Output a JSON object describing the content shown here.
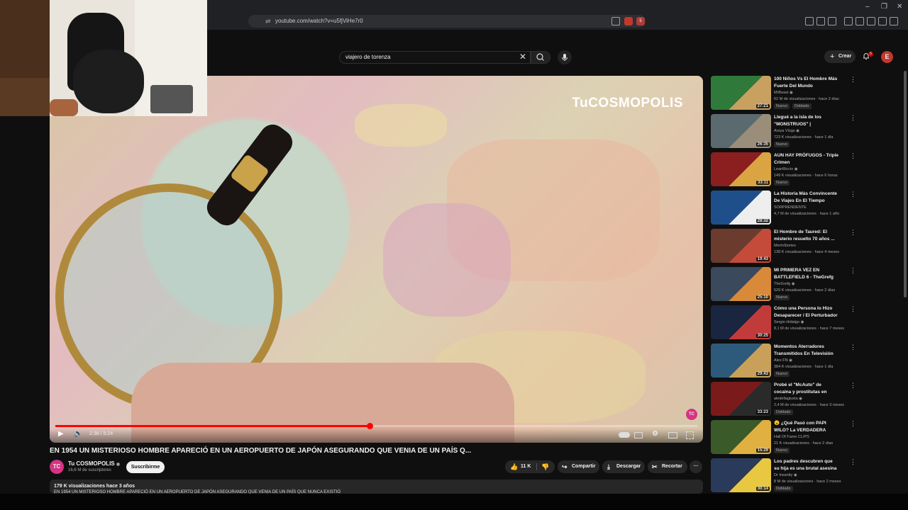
{
  "browser": {
    "url": "youtube.com/watch?v=u5fjViHe7r0",
    "ext_badge": "5",
    "win_minimize": "–",
    "win_maximize": "❐",
    "win_close": "✕",
    "page_close": "✕"
  },
  "header": {
    "search_value": "viajero de torenza",
    "search_clear": "✕",
    "create_label": "Crear",
    "notification_count": "5",
    "avatar_letter": "E"
  },
  "video": {
    "watermark": "TuCOSMOPOLIS",
    "time": "2:38 / 5:24",
    "progress": 0.49,
    "corner_badge": "TC",
    "title": "EN 1954 UN MISTERIOSO HOMBRE APARECIÓ EN UN AEROPUERTO DE JAPÓN ASEGURANDO QUE VENIA DE UN PAÍS Q..."
  },
  "channel": {
    "avatar_text": "TC",
    "name": "Tu COSMOPOLIS",
    "subscribers": "16,6 M de suscriptores",
    "subscribe_label": "Suscribirme"
  },
  "actions": {
    "likes": "11 K",
    "share": "Compartir",
    "download": "Descargar",
    "clip": "Recortar",
    "more": "···"
  },
  "description": {
    "meta": "179 K visualizaciones  hace 3 años",
    "text": "EN 1954 UN MISTERIOSO HOMBRE APARECIÓ EN UN AEROPUERTO DE JAPÓN ASEGURANDO QUE VENIA DE UN PAÍS QUE NUNCA EXISTIÓ"
  },
  "recommendations": [
    {
      "title": "100 Niños Vs El Hombre Más Fuerte Del Mundo",
      "channel": "MrBeast ◉",
      "meta": "62 M de visualizaciones · hace 2 días",
      "badges": [
        "Nuevo",
        "Doblado"
      ],
      "duration": "27:21",
      "colors": [
        "#2f7a3b",
        "#c8a060"
      ]
    },
    {
      "title": "Llegué a la isla de los \"MONSTRUOS\" | GALÁPAGOS ...",
      "channel": "Areya Vlogs ◉",
      "meta": "723 K visualizaciones · hace 1 día",
      "badges": [
        "Nuevo"
      ],
      "duration": "26:35",
      "colors": [
        "#5b6a6f",
        "#9a8e7a"
      ]
    },
    {
      "title": "AUN HAY PRÓFUGOS - Triple Crimen",
      "channel": "LeanRiccio ◉",
      "meta": "149 K visualizaciones · hace 6 horas",
      "badges": [
        "Nuevo"
      ],
      "duration": "33:11",
      "colors": [
        "#8b1e1e",
        "#d9a441"
      ]
    },
    {
      "title": "La Historia Más Convincente De Viajes En El Tiempo",
      "channel": "SORPRENDENTE",
      "meta": "4,7 M de visualizaciones · hace 1 año",
      "badges": [],
      "duration": "28:32",
      "colors": [
        "#1e4f8b",
        "#eeeeee"
      ]
    },
    {
      "title": "El Hombre de Taured: El misterio resuelto 70 años ...",
      "channel": "MerinStories",
      "meta": "138 K visualizaciones · hace 4 meses",
      "badges": [],
      "duration": "19:43",
      "colors": [
        "#6b3b2e",
        "#c44b3a"
      ]
    },
    {
      "title": "MI PRIMERA VEZ EN BATTLEFIELD 6 - TheGrefg",
      "channel": "TheGrefg ◉",
      "meta": "529 K visualizaciones · hace 2 días",
      "badges": [
        "Nuevo"
      ],
      "duration": "25:10",
      "colors": [
        "#3a4a5c",
        "#d88a3a"
      ]
    },
    {
      "title": "Cómo una Persona lo Hizo Desaparecer / El Perturbador ...",
      "channel": "Sergio Hidalgo ◉",
      "meta": "8,1 M de visualizaciones · hace 7 meses",
      "badges": [],
      "duration": "30:25",
      "colors": [
        "#1a2540",
        "#c23b3b"
      ]
    },
    {
      "title": "Momentos Aterradores Transmitidos En Televisión #3",
      "channel": "Alex FN ◉",
      "meta": "384 K visualizaciones · hace 1 día",
      "badges": [
        "Nuevo"
      ],
      "duration": "29:43",
      "colors": [
        "#2d5a7a",
        "#c9a05a"
      ]
    },
    {
      "title": "Probé el \"McAuto\" de cocaina y prostitutas en Medellín",
      "channel": "aledellagiusta ◉",
      "meta": "2,4 M de visualizaciones · hace 3 meses",
      "badges": [
        "Doblado"
      ],
      "duration": "33:23",
      "colors": [
        "#7a1a1a",
        "#2a2a2a"
      ]
    },
    {
      "title": "😮 ¿Qué Pasó con PAPI WILO? La VERDADERA HISTORIA ...",
      "channel": "Hall Of Fame CLIPS",
      "meta": "21 K visualizaciones · hace 2 días",
      "badges": [
        "Nuevo"
      ],
      "duration": "15:29",
      "colors": [
        "#3a5a2a",
        "#e0b040"
      ]
    },
    {
      "title": "Los padres descubren que su hija es una brutal asesina",
      "channel": "Dr Insanity ◉",
      "meta": "8 M de visualizaciones · hace 2 meses",
      "badges": [
        "Doblado"
      ],
      "duration": "30:14",
      "colors": [
        "#2a3a5a",
        "#e8c840"
      ]
    }
  ]
}
